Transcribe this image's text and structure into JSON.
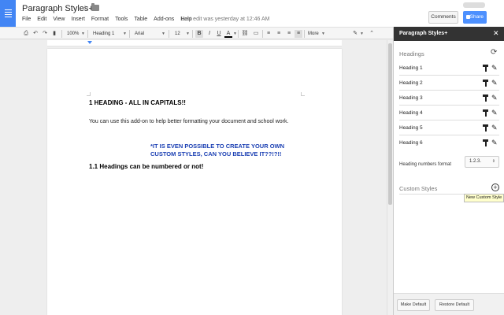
{
  "header": {
    "doc_title": "Paragraph Styles+",
    "menu": [
      "File",
      "Edit",
      "View",
      "Insert",
      "Format",
      "Tools",
      "Table",
      "Add-ons",
      "Help"
    ],
    "last_edit": "Last edit was yesterday at 12:46 AM",
    "comments_label": "Comments",
    "share_label": "Share"
  },
  "toolbar": {
    "zoom": "100%",
    "style": "Heading 1",
    "font": "Arial",
    "size": "12",
    "more_label": "More",
    "icons": [
      "print-icon",
      "undo-icon",
      "redo-icon",
      "paint-format-icon",
      "bold-icon",
      "italic-icon",
      "underline-icon",
      "text-color-icon",
      "link-icon",
      "comment-icon",
      "align-left-icon",
      "align-center-icon",
      "align-right-icon",
      "justify-icon",
      "pen-icon",
      "collapse-icon"
    ]
  },
  "document": {
    "heading1": "1 HEADING - ALL IN CAPITALS!!",
    "body": "You can use this add-on to help better formatting your document and school work.",
    "custom_style": "*IT IS EVEN POSSIBLE TO CREATE YOUR OWN CUSTOM STYLES, CAN YOU BELIEVE IT??!?!!",
    "heading2": "1.1 Headings can be numbered or not!"
  },
  "sidebar": {
    "title": "Paragraph Styles+",
    "headings_label": "Headings",
    "headings": [
      "Heading 1",
      "Heading 2",
      "Heading 3",
      "Heading 4",
      "Heading 5",
      "Heading 6"
    ],
    "numbers_label": "Heading numbers format",
    "numbers_value": "1.2.3.",
    "custom_styles_label": "Custom Styles",
    "tooltip": "New Custom Style",
    "make_default_label": "Make Default",
    "restore_default_label": "Restore Default"
  },
  "colors": {
    "accent": "#4285f4",
    "custom_text": "#1a3fb3",
    "sidebar_header": "#333333",
    "share": "#4d90fe"
  }
}
